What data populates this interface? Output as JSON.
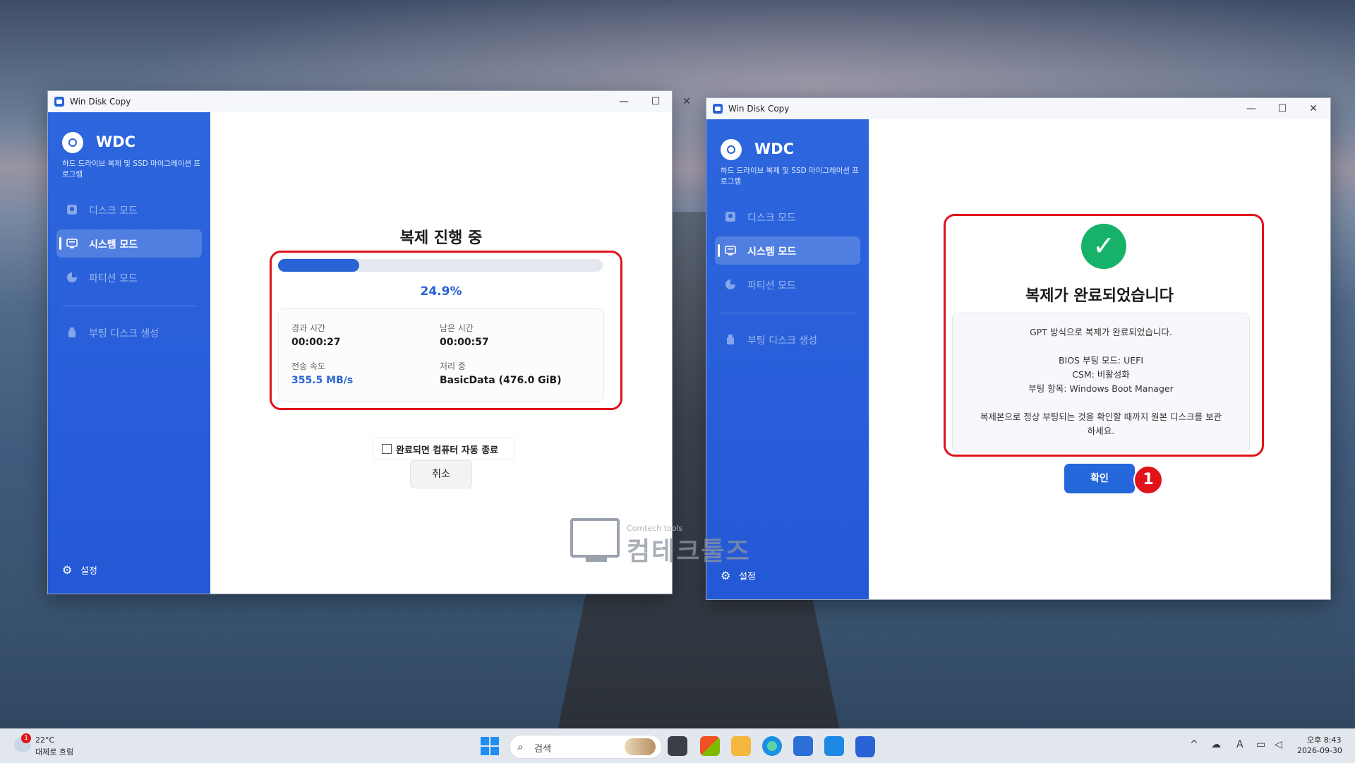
{
  "app": {
    "window_title": "Win Disk Copy",
    "brand": "WDC",
    "subtitle": "하드 드라이브 복제 및 SSD 마이그레이션 프로그램",
    "nav": [
      {
        "label": "디스크 모드",
        "icon": "disk-icon"
      },
      {
        "label": "시스템 모드",
        "icon": "monitor-icon"
      },
      {
        "label": "파티션 모드",
        "icon": "pie-chart-icon"
      },
      {
        "label": "부팅 디스크 생성",
        "icon": "usb-drive-icon"
      }
    ],
    "settings_label": "설정",
    "window_controls": {
      "minimize": "—",
      "maximize": "☐",
      "close": "✕"
    }
  },
  "progress_window": {
    "title": "복제 진행 중",
    "progress": 0.249,
    "percent_text": "24.9%",
    "stats": {
      "elapsed_label": "경과 시간",
      "elapsed_value": "00:00:27",
      "remaining_label": "남은 시간",
      "remaining_value": "00:00:57",
      "speed_label": "전송 속도",
      "speed_value": "355.5 MB/s",
      "processing_label": "처리 중",
      "processing_value": "BasicData (476.0 GiB)"
    },
    "auto_shutdown_label": "완료되면 컴퓨터 자동 종료",
    "cancel_label": "취소"
  },
  "done_window": {
    "check_glyph": "✓",
    "title": "복제가 완료되었습니다",
    "info_lines": [
      "GPT 방식으로 복제가 완료되었습니다.",
      "BIOS 부팅 모드: UEFI",
      "CSM: 비활성화",
      "부팅 항목: Windows Boot Manager",
      "복제본으로 정상 부팅되는 것을 확인할 때까지 원본 디스크를 보관",
      "하세요."
    ],
    "confirm_label": "확인",
    "step_badge": "1"
  },
  "watermark": {
    "small": "Comtech tools",
    "big": "컴테크툴즈"
  },
  "taskbar": {
    "weather_badge": "1",
    "weather_temp": "22°C",
    "weather_desc": "대체로 흐림",
    "search_placeholder": "검색",
    "tray_ime": "A",
    "clock_time": "오후 8:43",
    "clock_date": "2026-09-30"
  },
  "colors": {
    "accent": "#2a63d6",
    "highlight_red": "#e0131b",
    "success_green": "#17b26a"
  }
}
